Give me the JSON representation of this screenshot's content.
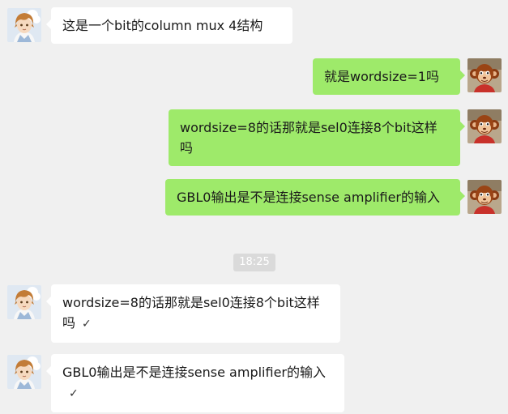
{
  "messages": [
    {
      "side": "in",
      "text": "这是一个bit的column mux 4结构"
    },
    {
      "side": "out",
      "text": "就是wordsize=1吗"
    },
    {
      "side": "out",
      "text": "wordsize=8的话那就是sel0连接8个bit这样吗"
    },
    {
      "side": "out",
      "text": "GBL0输出是不是连接sense amplifier的输入"
    },
    {
      "side": "in",
      "text": "wordsize=8的话那就是sel0连接8个bit这样吗",
      "check": "✓"
    },
    {
      "side": "in",
      "text": "GBL0输出是不是连接sense amplifier的输入",
      "check": "✓"
    }
  ],
  "timestamp": "18:25",
  "avatars": {
    "left": "anime-boy-avatar",
    "right": "cartoon-monkey-avatar"
  }
}
